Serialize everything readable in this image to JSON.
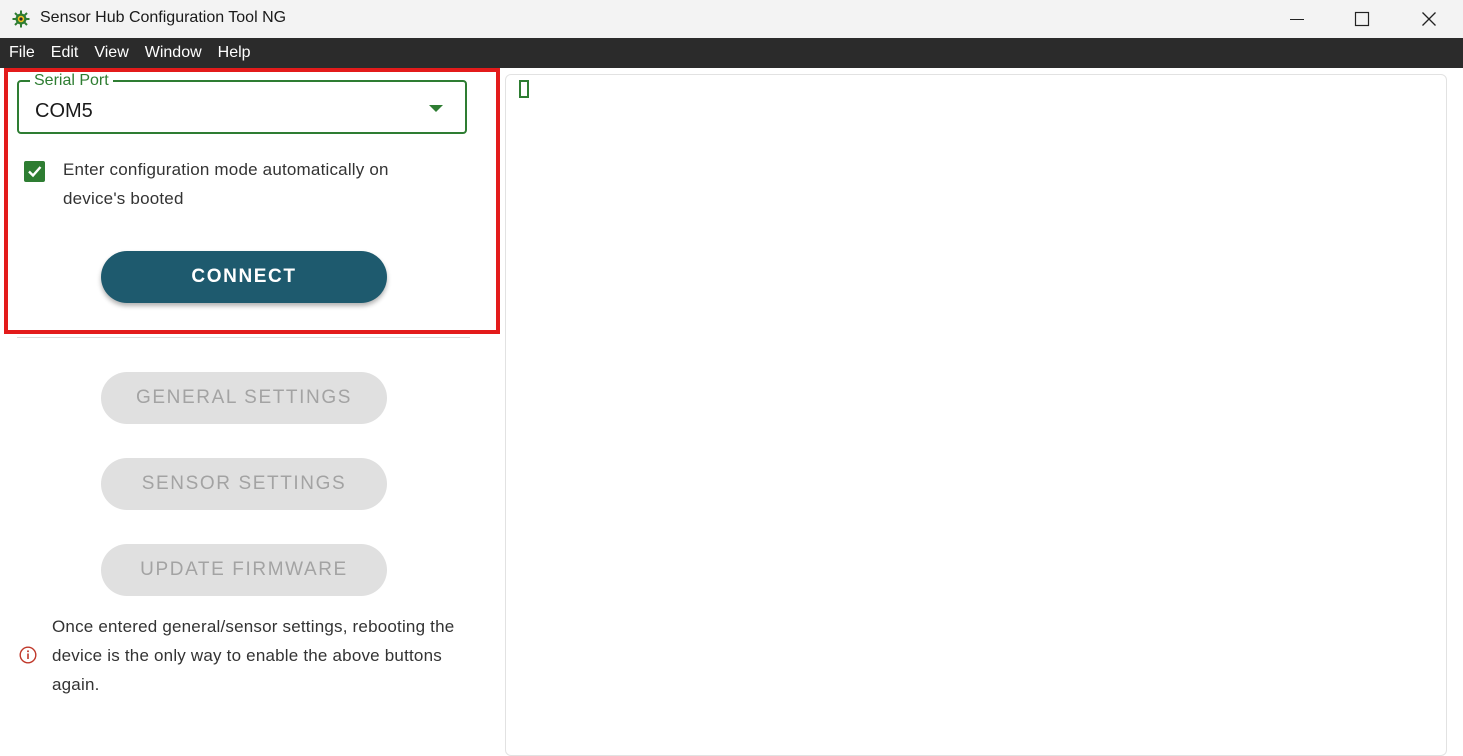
{
  "window": {
    "title": "Sensor Hub Configuration Tool NG",
    "controls": [
      "minimize",
      "maximize",
      "close"
    ]
  },
  "menu": [
    "File",
    "Edit",
    "View",
    "Window",
    "Help"
  ],
  "connection": {
    "serial_port_label": "Serial Port",
    "serial_port_value": "COM5",
    "auto_config_label": "Enter configuration mode automatically on device's booted",
    "auto_config_checked": true,
    "connect_label": "CONNECT"
  },
  "actions": {
    "general_settings": "GENERAL SETTINGS",
    "sensor_settings": "SENSOR SETTINGS",
    "update_firmware": "UPDATE FIRMWARE"
  },
  "info_note": "Once entered general/sensor settings, rebooting the device is the only way to enable the above buttons again.",
  "colors": {
    "accent_green": "#2e7d32",
    "connect_button": "#1e5a6e",
    "highlight_red": "#e31b1b",
    "info_icon": "#c0392b"
  }
}
